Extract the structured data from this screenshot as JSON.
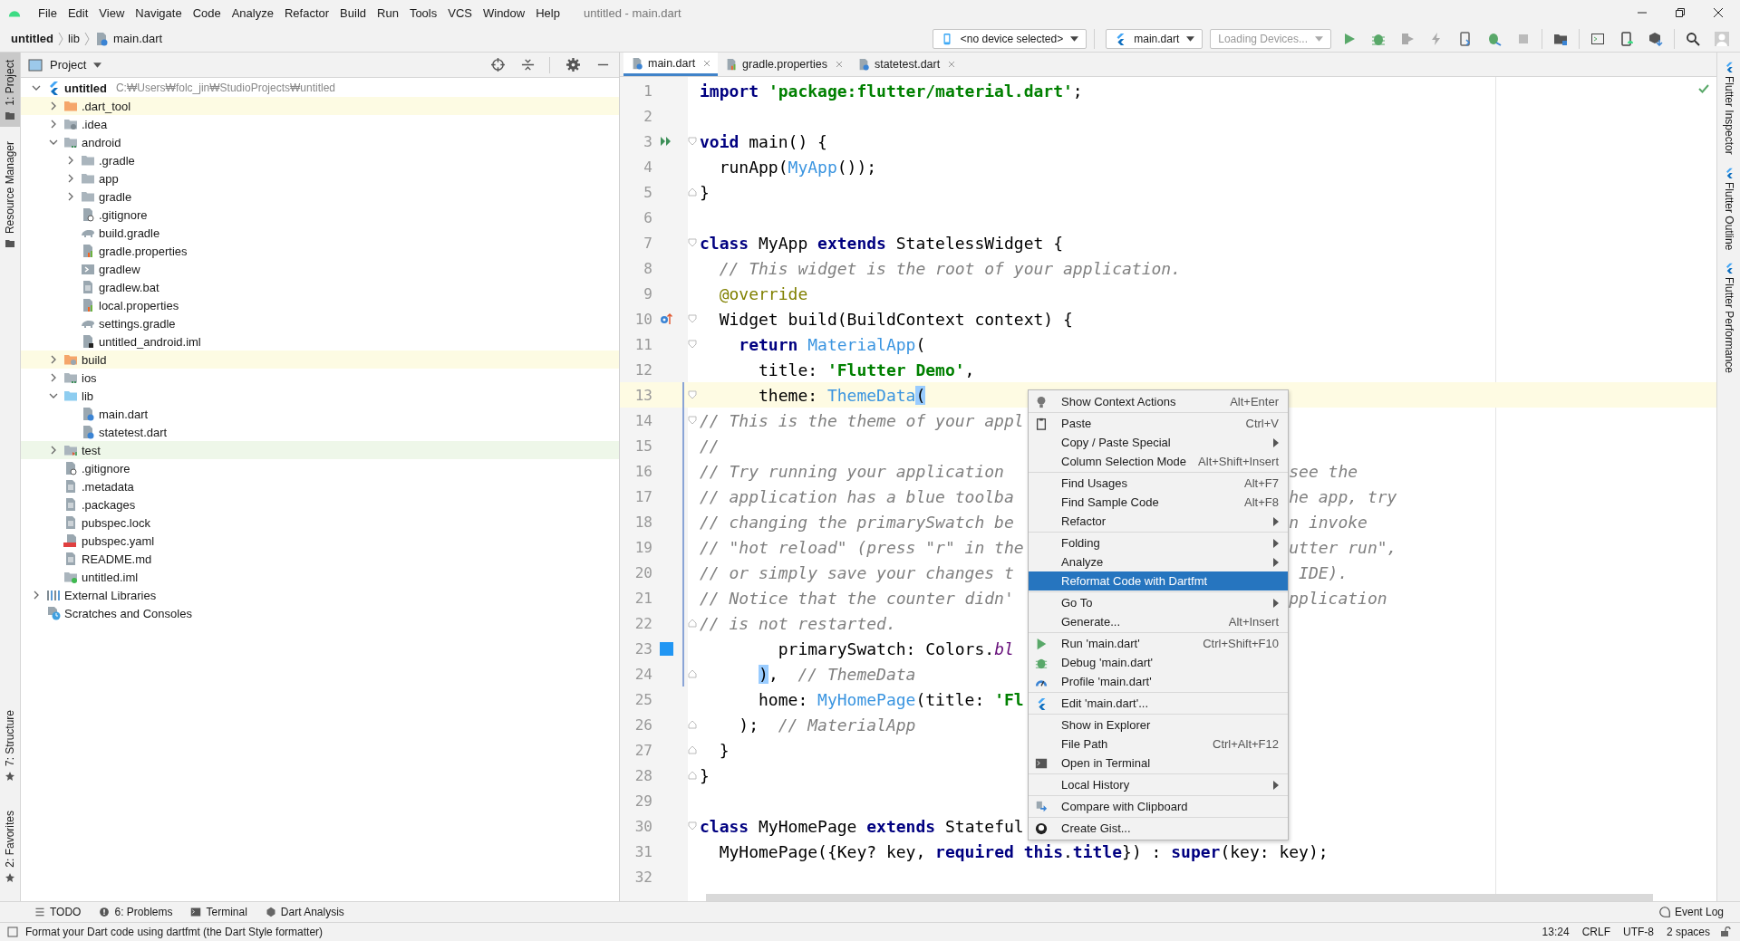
{
  "window": {
    "title": "untitled - main.dart",
    "menu": [
      "File",
      "Edit",
      "View",
      "Navigate",
      "Code",
      "Analyze",
      "Refactor",
      "Build",
      "Run",
      "Tools",
      "VCS",
      "Window",
      "Help"
    ]
  },
  "breadcrumb": [
    "untitled",
    "lib",
    "main.dart"
  ],
  "toolbar": {
    "device": "<no device selected>",
    "run_config": "main.dart",
    "devices": "Loading Devices..."
  },
  "left_strip": [
    {
      "label": "1: Project",
      "selected": true
    },
    {
      "label": "Resource Manager",
      "selected": false
    }
  ],
  "left_strip_bottom": [
    {
      "label": "7: Structure",
      "selected": false
    },
    {
      "label": "2: Favorites",
      "selected": false
    }
  ],
  "right_strip": [
    "Flutter Inspector",
    "Flutter Outline",
    "Flutter Performance"
  ],
  "project": {
    "title": "Project",
    "tree": [
      {
        "name": "untitled",
        "path": "C:₩Users₩folc_jin₩StudioProjects₩untitled",
        "kind": "flutter",
        "expanded": true,
        "children": [
          {
            "name": ".dart_tool",
            "kind": "folder_excluded",
            "expanded": false
          },
          {
            "name": ".idea",
            "kind": "folder_idea",
            "expanded": false
          },
          {
            "name": "android",
            "kind": "folder_module",
            "expanded": true,
            "children": [
              {
                "name": ".gradle",
                "kind": "folder",
                "expanded": false
              },
              {
                "name": "app",
                "kind": "folder",
                "expanded": false
              },
              {
                "name": "gradle",
                "kind": "folder",
                "expanded": false
              },
              {
                "name": ".gitignore",
                "kind": "file_git"
              },
              {
                "name": "build.gradle",
                "kind": "file_gradle"
              },
              {
                "name": "gradle.properties",
                "kind": "file_props"
              },
              {
                "name": "gradlew",
                "kind": "file_exec"
              },
              {
                "name": "gradlew.bat",
                "kind": "file_text"
              },
              {
                "name": "local.properties",
                "kind": "file_props"
              },
              {
                "name": "settings.gradle",
                "kind": "file_gradle"
              },
              {
                "name": "untitled_android.iml",
                "kind": "file_iml"
              }
            ]
          },
          {
            "name": "build",
            "kind": "folder_excluded_module",
            "expanded": false
          },
          {
            "name": "ios",
            "kind": "folder_module",
            "expanded": false
          },
          {
            "name": "lib",
            "kind": "folder_src",
            "expanded": true,
            "children": [
              {
                "name": "main.dart",
                "kind": "file_dart"
              },
              {
                "name": "statetest.dart",
                "kind": "file_dart"
              }
            ]
          },
          {
            "name": "test",
            "kind": "folder_test",
            "expanded": false
          },
          {
            "name": ".gitignore",
            "kind": "file_git"
          },
          {
            "name": ".metadata",
            "kind": "file_text"
          },
          {
            "name": ".packages",
            "kind": "file_text"
          },
          {
            "name": "pubspec.lock",
            "kind": "file_text"
          },
          {
            "name": "pubspec.yaml",
            "kind": "file_yaml"
          },
          {
            "name": "README.md",
            "kind": "file_text"
          },
          {
            "name": "untitled.iml",
            "kind": "file_module_iml"
          }
        ]
      },
      {
        "name": "External Libraries",
        "kind": "libraries",
        "expanded": false
      },
      {
        "name": "Scratches and Consoles",
        "kind": "scratches"
      }
    ]
  },
  "tabs": [
    {
      "label": "main.dart",
      "kind": "dart",
      "selected": true
    },
    {
      "label": "gradle.properties",
      "kind": "props",
      "selected": false
    },
    {
      "label": "statetest.dart",
      "kind": "dart",
      "selected": false
    }
  ],
  "code": {
    "lines": [
      {
        "number": "1",
        "kind": "plain",
        "fold_start": false,
        "fold_end": false,
        "current": false,
        "changed": false,
        "tokens": [
          {
            "kind": "keyword",
            "text": "import"
          },
          {
            "kind": "string",
            "text": " 'package:flutter/material.dart'"
          },
          {
            "kind": "plain",
            "text": ";"
          }
        ]
      },
      {
        "number": "2",
        "kind": "plain",
        "fold_start": false,
        "fold_end": false,
        "current": false,
        "changed": false
      },
      {
        "number": "3",
        "kind": "run",
        "fold_start": true,
        "fold_end": false,
        "current": false,
        "changed": false,
        "tokens": [
          {
            "kind": "keyword",
            "text": "void"
          },
          {
            "kind": "plain",
            "text": " main() {"
          }
        ]
      },
      {
        "number": "4",
        "kind": "plain",
        "fold_start": false,
        "fold_end": false,
        "current": false,
        "changed": false,
        "tokens": [
          {
            "kind": "plain",
            "text": "  runApp("
          },
          {
            "kind": "class",
            "text": "MyApp"
          },
          {
            "kind": "plain",
            "text": "());"
          }
        ]
      },
      {
        "number": "5",
        "kind": "plain",
        "fold_start": false,
        "fold_end": true,
        "current": false,
        "changed": false,
        "tokens": [
          {
            "kind": "plain",
            "text": "}"
          }
        ]
      },
      {
        "number": "6",
        "kind": "plain",
        "fold_start": false,
        "fold_end": false,
        "current": false,
        "changed": false
      },
      {
        "number": "7",
        "kind": "plain",
        "fold_start": true,
        "fold_end": false,
        "current": false,
        "changed": false,
        "tokens": [
          {
            "kind": "keyword",
            "text": "class"
          },
          {
            "kind": "plain",
            "text": " MyApp "
          },
          {
            "kind": "keyword",
            "text": "extends"
          },
          {
            "kind": "plain",
            "text": " StatelessWidget {"
          }
        ]
      },
      {
        "number": "8",
        "kind": "plain",
        "fold_start": false,
        "fold_end": false,
        "current": false,
        "changed": false,
        "tokens": [
          {
            "kind": "comment",
            "text": "  // This widget is the root of your application."
          }
        ]
      },
      {
        "number": "9",
        "kind": "plain",
        "fold_start": false,
        "fold_end": false,
        "current": false,
        "changed": false,
        "tokens": [
          {
            "kind": "annotation",
            "text": "  @override"
          }
        ]
      },
      {
        "number": "10",
        "kind": "override",
        "fold_start": true,
        "fold_end": false,
        "current": false,
        "changed": false,
        "tokens": [
          {
            "kind": "plain",
            "text": "  Widget build(BuildContext context) {"
          }
        ]
      },
      {
        "number": "11",
        "kind": "plain",
        "fold_start": true,
        "fold_end": false,
        "current": false,
        "changed": false,
        "tokens": [
          {
            "kind": "keyword",
            "text": "    return"
          },
          {
            "kind": "class",
            "text": " MaterialApp"
          },
          {
            "kind": "plain",
            "text": "("
          }
        ]
      },
      {
        "number": "12",
        "kind": "plain",
        "fold_start": false,
        "fold_end": false,
        "current": false,
        "changed": false,
        "tokens": [
          {
            "kind": "plain",
            "text": "      title: "
          },
          {
            "kind": "string",
            "text": "'Flutter Demo'"
          },
          {
            "kind": "plain",
            "text": ","
          }
        ]
      },
      {
        "number": "13",
        "kind": "plain",
        "fold_start": true,
        "fold_end": false,
        "current": true,
        "changed": true,
        "tokens": [
          {
            "kind": "plain",
            "text": "      theme: "
          },
          {
            "kind": "class",
            "text": "ThemeData"
          },
          {
            "kind": "brace",
            "text": "("
          }
        ]
      },
      {
        "number": "14",
        "kind": "plain",
        "fold_start": true,
        "fold_end": false,
        "current": false,
        "changed": true,
        "tokens": [
          {
            "kind": "comment",
            "text": "// This is the theme of your appl"
          }
        ]
      },
      {
        "number": "15",
        "kind": "plain",
        "fold_start": false,
        "fold_end": false,
        "current": false,
        "changed": true,
        "tokens": [
          {
            "kind": "comment",
            "text": "//"
          }
        ]
      },
      {
        "number": "16",
        "kind": "plain",
        "fold_start": false,
        "fold_end": false,
        "current": false,
        "changed": true,
        "tokens": [
          {
            "kind": "comment",
            "text": "// Try running your application"
          }
        ],
        "right": [
          {
            "kind": "comment",
            "text": "see the"
          }
        ]
      },
      {
        "number": "17",
        "kind": "plain",
        "fold_start": false,
        "fold_end": false,
        "current": false,
        "changed": true,
        "tokens": [
          {
            "kind": "comment",
            "text": "// application has a blue toolba"
          }
        ],
        "right": [
          {
            "kind": "comment",
            "text": "he app, try"
          }
        ]
      },
      {
        "number": "18",
        "kind": "plain",
        "fold_start": false,
        "fold_end": false,
        "current": false,
        "changed": true,
        "tokens": [
          {
            "kind": "comment",
            "text": "// changing the primarySwatch be"
          }
        ],
        "right": [
          {
            "kind": "comment",
            "text": "n invoke"
          }
        ]
      },
      {
        "number": "19",
        "kind": "plain",
        "fold_start": false,
        "fold_end": false,
        "current": false,
        "changed": true,
        "tokens": [
          {
            "kind": "comment",
            "text": "// \"hot reload\" (press \"r\" in the"
          }
        ],
        "right": [
          {
            "kind": "comment",
            "text": "utter run\","
          }
        ]
      },
      {
        "number": "20",
        "kind": "plain",
        "fold_start": false,
        "fold_end": false,
        "current": false,
        "changed": true,
        "tokens": [
          {
            "kind": "comment",
            "text": "// or simply save your changes t"
          }
        ],
        "right": [
          {
            "kind": "comment",
            "text": " IDE)."
          }
        ]
      },
      {
        "number": "21",
        "kind": "plain",
        "fold_start": false,
        "fold_end": false,
        "current": false,
        "changed": true,
        "tokens": [
          {
            "kind": "comment",
            "text": "// Notice that the counter didn'"
          }
        ],
        "right": [
          {
            "kind": "comment",
            "text": "pplication"
          }
        ]
      },
      {
        "number": "22",
        "kind": "plain",
        "fold_start": false,
        "fold_end": true,
        "current": false,
        "changed": true,
        "tokens": [
          {
            "kind": "comment",
            "text": "// is not restarted."
          }
        ]
      },
      {
        "number": "23",
        "kind": "color",
        "fold_start": false,
        "fold_end": false,
        "current": false,
        "changed": true,
        "tokens": [
          {
            "kind": "plain",
            "text": "        primarySwatch: Colors."
          },
          {
            "kind": "field",
            "text": "bl"
          }
        ]
      },
      {
        "number": "24",
        "kind": "plain",
        "fold_start": false,
        "fold_end": true,
        "current": false,
        "changed": true,
        "tokens": [
          {
            "kind": "brace",
            "text": "      )"
          },
          {
            "kind": "plain",
            "text": ",  "
          },
          {
            "kind": "comment",
            "text": "// ThemeData"
          }
        ]
      },
      {
        "number": "25",
        "kind": "plain",
        "fold_start": false,
        "fold_end": false,
        "current": false,
        "changed": false,
        "tokens": [
          {
            "kind": "plain",
            "text": "      home: "
          },
          {
            "kind": "class",
            "text": "MyHomePage"
          },
          {
            "kind": "plain",
            "text": "(title: "
          },
          {
            "kind": "string",
            "text": "'Fl"
          }
        ]
      },
      {
        "number": "26",
        "kind": "plain",
        "fold_start": false,
        "fold_end": true,
        "current": false,
        "changed": false,
        "tokens": [
          {
            "kind": "plain",
            "text": "    );  "
          },
          {
            "kind": "comment",
            "text": "// MaterialApp"
          }
        ]
      },
      {
        "number": "27",
        "kind": "plain",
        "fold_start": false,
        "fold_end": true,
        "current": false,
        "changed": false,
        "tokens": [
          {
            "kind": "plain",
            "text": "  }"
          }
        ]
      },
      {
        "number": "28",
        "kind": "plain",
        "fold_start": false,
        "fold_end": true,
        "current": false,
        "changed": false,
        "tokens": [
          {
            "kind": "plain",
            "text": "}"
          }
        ]
      },
      {
        "number": "29",
        "kind": "plain",
        "fold_start": false,
        "fold_end": false,
        "current": false,
        "changed": false
      },
      {
        "number": "30",
        "kind": "plain",
        "fold_start": true,
        "fold_end": false,
        "current": false,
        "changed": false,
        "tokens": [
          {
            "kind": "keyword",
            "text": "class"
          },
          {
            "kind": "plain",
            "text": " MyHomePage "
          },
          {
            "kind": "keyword",
            "text": "extends"
          },
          {
            "kind": "plain",
            "text": " Stateful"
          }
        ]
      },
      {
        "number": "31",
        "kind": "plain",
        "fold_start": false,
        "fold_end": false,
        "current": false,
        "changed": false,
        "tokens": [
          {
            "kind": "plain",
            "text": "  MyHomePage({Key? key, "
          },
          {
            "kind": "keyword",
            "text": "required"
          },
          {
            "kind": "keyword",
            "text": " this"
          },
          {
            "kind": "plain",
            "text": "."
          },
          {
            "kind": "keyword",
            "text": "title"
          },
          {
            "kind": "plain",
            "text": "}) : "
          },
          {
            "kind": "keyword",
            "text": "super"
          },
          {
            "kind": "plain",
            "text": "(key: key);"
          }
        ]
      },
      {
        "number": "32",
        "kind": "plain",
        "fold_start": false,
        "fold_end": false,
        "current": false,
        "changed": false
      }
    ]
  },
  "context_menu": {
    "groups": [
      [
        {
          "label": "Show Context Actions",
          "shortcut": "Alt+Enter",
          "submenu": false,
          "selected": false
        }
      ],
      [
        {
          "label": "Paste",
          "shortcut": "Ctrl+V",
          "submenu": false,
          "selected": false
        },
        {
          "label": "Copy / Paste Special",
          "submenu": true,
          "selected": false
        },
        {
          "label": "Column Selection Mode",
          "shortcut": "Alt+Shift+Insert",
          "submenu": false,
          "selected": false
        }
      ],
      [
        {
          "label": "Find Usages",
          "shortcut": "Alt+F7",
          "submenu": false,
          "selected": false
        },
        {
          "label": "Find Sample Code",
          "shortcut": "Alt+F8",
          "submenu": false,
          "selected": false
        },
        {
          "label": "Refactor",
          "submenu": true,
          "selected": false
        }
      ],
      [
        {
          "label": "Folding",
          "submenu": true,
          "selected": false
        },
        {
          "label": "Analyze",
          "submenu": true,
          "selected": false
        },
        {
          "label": "Reformat Code with Dartfmt",
          "submenu": false,
          "selected": true
        }
      ],
      [
        {
          "label": "Go To",
          "submenu": true,
          "selected": false
        },
        {
          "label": "Generate...",
          "shortcut": "Alt+Insert",
          "submenu": false,
          "selected": false
        }
      ],
      [
        {
          "label": "Run 'main.dart'",
          "shortcut": "Ctrl+Shift+F10",
          "submenu": false,
          "selected": false
        },
        {
          "label": "Debug 'main.dart'",
          "submenu": false,
          "selected": false
        },
        {
          "label": "Profile 'main.dart'",
          "submenu": false,
          "selected": false
        }
      ],
      [
        {
          "label": "Edit 'main.dart'...",
          "submenu": false,
          "selected": false
        }
      ],
      [
        {
          "label": "Show in Explorer",
          "submenu": false,
          "selected": false
        },
        {
          "label": "File Path",
          "shortcut": "Ctrl+Alt+F12",
          "submenu": false,
          "selected": false
        },
        {
          "label": "Open in Terminal",
          "submenu": false,
          "selected": false
        }
      ],
      [
        {
          "label": "Local History",
          "submenu": true,
          "selected": false
        }
      ],
      [
        {
          "label": "Compare with Clipboard",
          "submenu": false,
          "selected": false
        }
      ],
      [
        {
          "label": "Create Gist...",
          "submenu": false,
          "selected": false
        }
      ]
    ]
  },
  "tool_windows": [
    {
      "label": "TODO",
      "kind": "todo"
    },
    {
      "label": "6: Problems",
      "kind": "problems"
    },
    {
      "label": "Terminal",
      "kind": "terminal"
    },
    {
      "label": "Dart Analysis",
      "kind": "analysis"
    }
  ],
  "event_log": "Event Log",
  "status": {
    "message": "Format your Dart code using dartfmt (the Dart Style formatter)",
    "position": "13:24",
    "line_separator": "CRLF",
    "encoding": "UTF-8",
    "indent": "2 spaces"
  }
}
